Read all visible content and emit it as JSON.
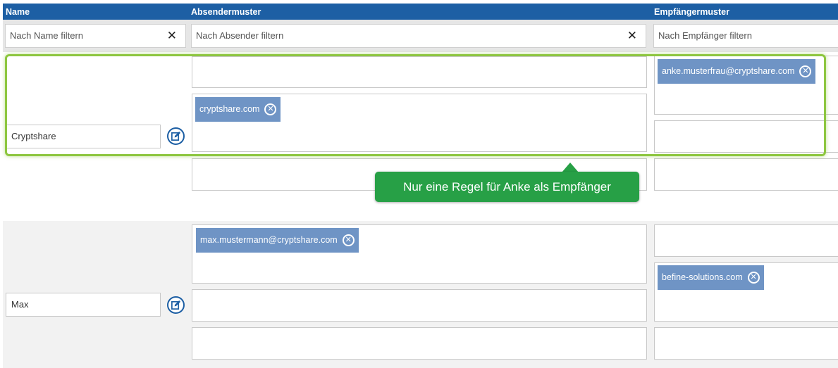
{
  "header": {
    "col_name": "Name",
    "col_sender": "Absendermuster",
    "col_recipient": "Empfängermuster"
  },
  "filters": {
    "name_placeholder": "Nach Name filtern",
    "sender_placeholder": "Nach Absender filtern",
    "recipient_placeholder": "Nach Empfänger filtern",
    "clear_symbol": "✕"
  },
  "rules": [
    {
      "name": "Cryptshare",
      "sender_tags": [
        "cryptshare.com"
      ],
      "recipient_tags": [
        "anke.musterfrau@cryptshare.com"
      ]
    },
    {
      "name": "Max",
      "sender_tags": [
        "max.mustermann@cryptshare.com"
      ],
      "recipient_tags": [
        "befine-solutions.com"
      ]
    }
  ],
  "callout": {
    "text": "Nur eine Regel für Anke als Empfänger"
  },
  "icons": {
    "remove_tag": "remove-circle-icon",
    "edit": "edit-icon",
    "clear": "close-icon"
  },
  "colors": {
    "header_bg": "#1d5fa4",
    "tag_bg": "#6f94c5",
    "highlight": "#8dc63f",
    "callout_bg": "#27a046"
  }
}
